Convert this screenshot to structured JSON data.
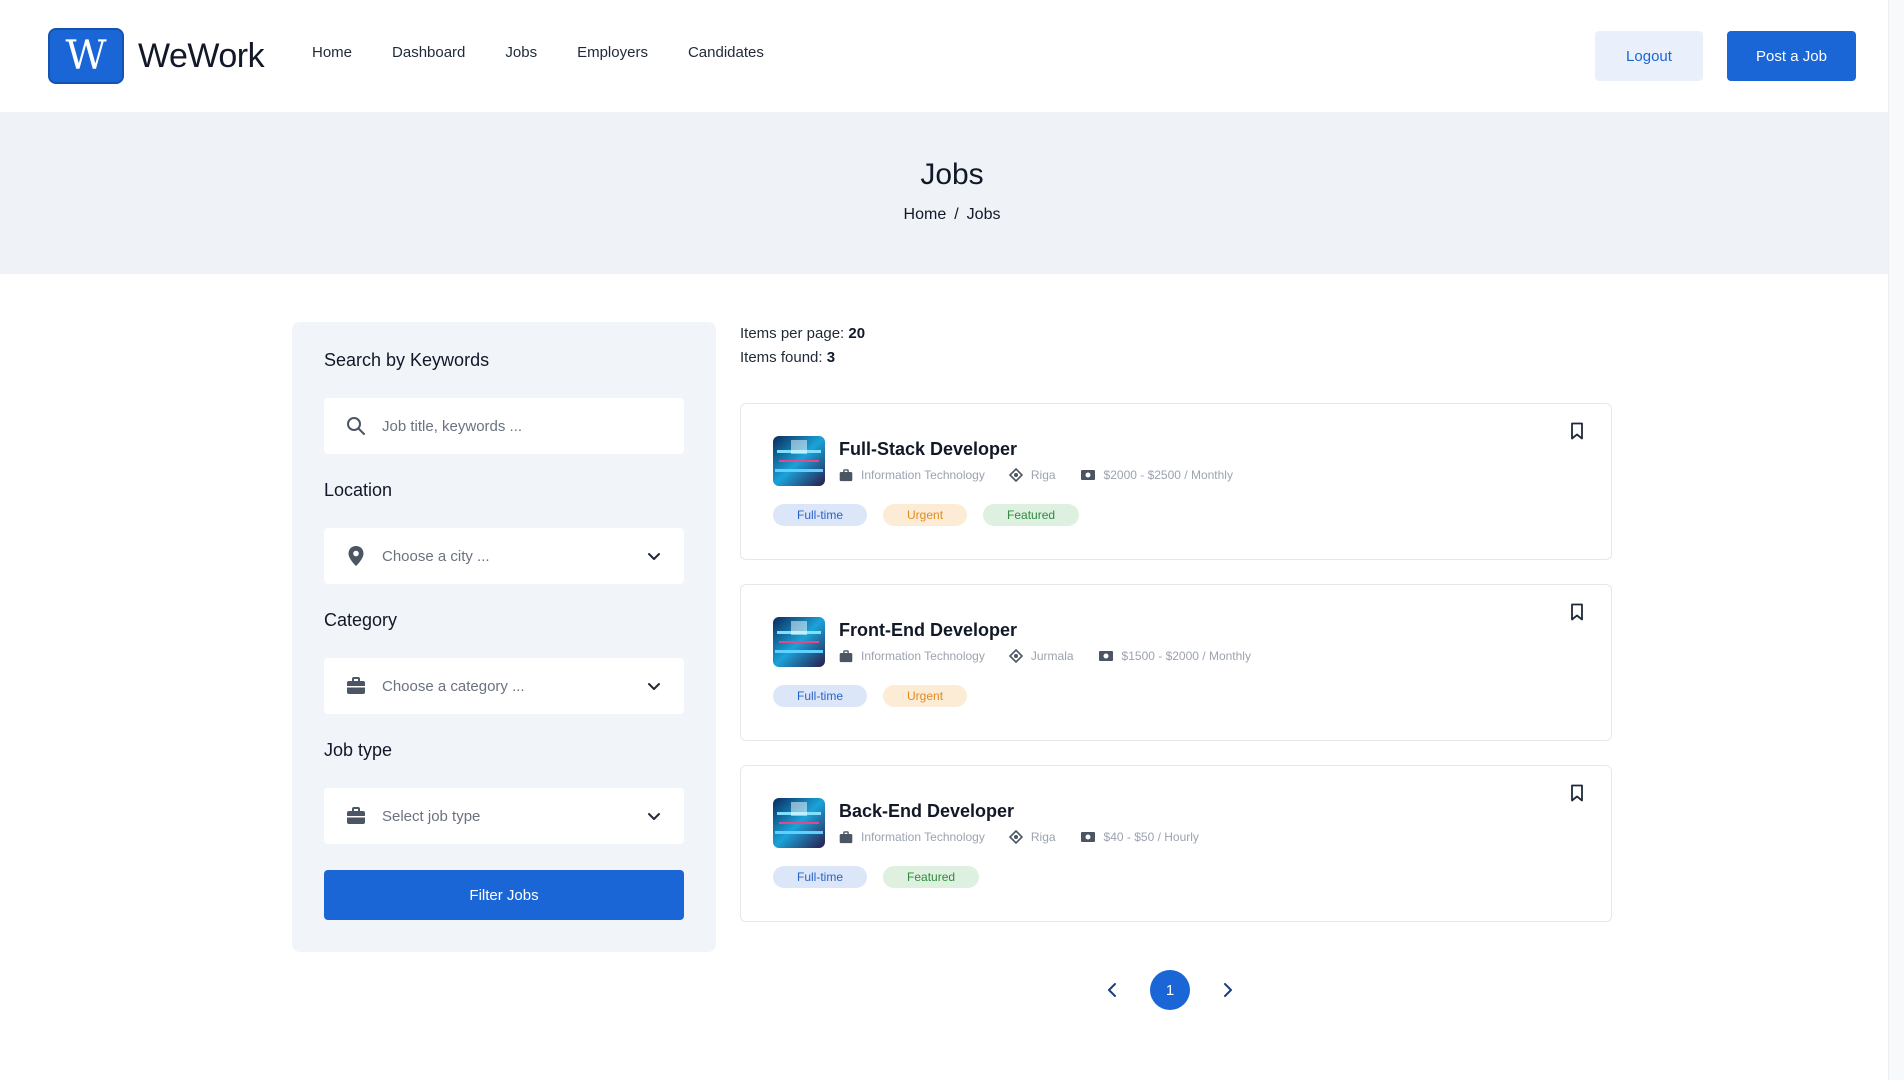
{
  "brand": {
    "logo_letter": "W",
    "name": "WeWork"
  },
  "nav": [
    "Home",
    "Dashboard",
    "Jobs",
    "Employers",
    "Candidates"
  ],
  "header_buttons": {
    "logout": "Logout",
    "post_job": "Post a Job"
  },
  "hero": {
    "title": "Jobs",
    "breadcrumb": [
      "Home",
      "Jobs"
    ],
    "separator": "/"
  },
  "sidebar": {
    "keywords_label": "Search by Keywords",
    "keywords_placeholder": "Job title, keywords ...",
    "location_label": "Location",
    "location_placeholder": "Choose a city ...",
    "category_label": "Category",
    "category_placeholder": "Choose a category ...",
    "jobtype_label": "Job type",
    "jobtype_placeholder": "Select job type",
    "filter_button": "Filter Jobs"
  },
  "results": {
    "per_page_label": "Items per page:",
    "per_page_value": "20",
    "found_label": "Items found:",
    "found_value": "3"
  },
  "jobs": [
    {
      "title": "Full-Stack Developer",
      "category": "Information Technology",
      "location": "Riga",
      "salary": "$2000 - $2500 / Monthly",
      "tags": [
        "Full-time",
        "Urgent",
        "Featured"
      ]
    },
    {
      "title": "Front-End Developer",
      "category": "Information Technology",
      "location": "Jurmala",
      "salary": "$1500 - $2000 / Monthly",
      "tags": [
        "Full-time",
        "Urgent"
      ]
    },
    {
      "title": "Back-End Developer",
      "category": "Information Technology",
      "location": "Riga",
      "salary": "$40 - $50 / Hourly",
      "tags": [
        "Full-time",
        "Featured"
      ]
    }
  ],
  "pagination": {
    "current": "1"
  },
  "colors": {
    "accent": "#1a66d6",
    "hero_bg": "#eff3f7",
    "sidebar_bg": "#f1f4f9"
  }
}
